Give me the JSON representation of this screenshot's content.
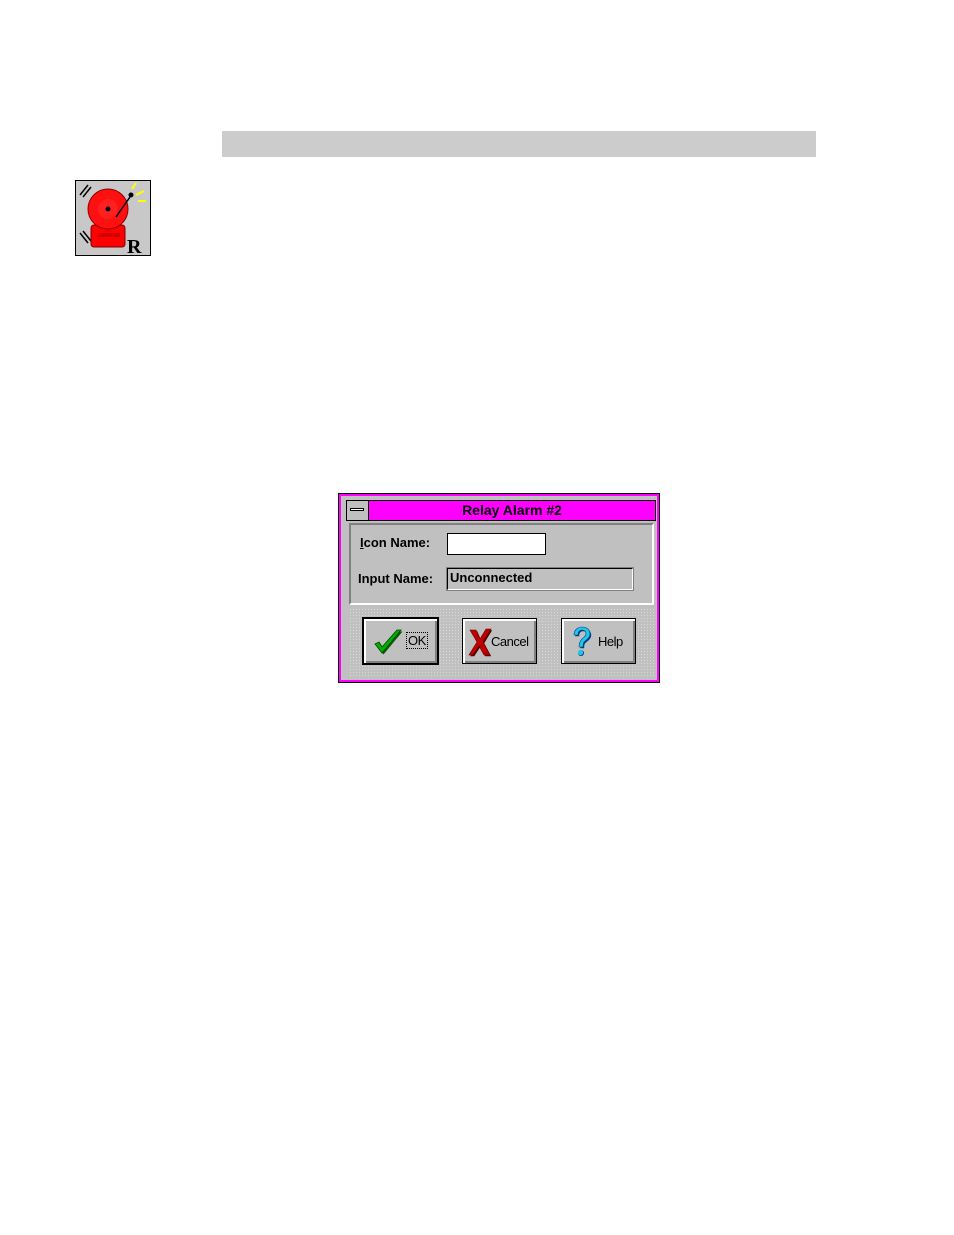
{
  "page": {
    "header_bar_color": "#cccccc"
  },
  "app_icon": {
    "icon": "relay-alarm-bell-icon",
    "badge": "R"
  },
  "dialog": {
    "title": "Relay Alarm #2",
    "title_bar_color": "#ff00ff",
    "system_menu_icon": "system-menu-icon",
    "icon_name": {
      "label_mnemonic": "I",
      "label_rest": "con Name:",
      "value": ""
    },
    "input_name": {
      "label": "Input Name:",
      "value": "Unconnected"
    },
    "buttons": {
      "ok": {
        "label": "OK",
        "icon": "checkmark-icon"
      },
      "cancel": {
        "label": "Cancel",
        "icon": "x-mark-icon"
      },
      "help": {
        "label": "Help",
        "icon": "question-mark-icon"
      }
    }
  }
}
